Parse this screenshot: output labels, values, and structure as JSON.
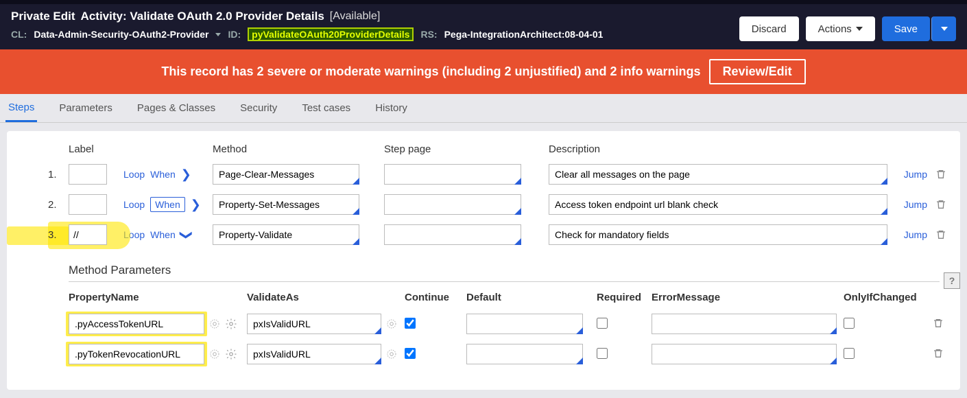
{
  "header": {
    "prefix": "Private Edit",
    "title": "Activity: Validate OAuth 2.0 Provider Details",
    "status": "[Available]",
    "cl_key": "CL:",
    "cl_val": "Data-Admin-Security-OAuth2-Provider",
    "id_key": "ID:",
    "id_val": "pyValidateOAuth20ProviderDetails",
    "rs_key": "RS:",
    "rs_val": "Pega-IntegrationArchitect:08-04-01",
    "buttons": {
      "discard": "Discard",
      "actions": "Actions",
      "save": "Save"
    }
  },
  "warning": {
    "text": "This record has 2 severe or moderate warnings (including 2 unjustified) and 2 info warnings",
    "review": "Review/Edit"
  },
  "tabs": [
    "Steps",
    "Parameters",
    "Pages & Classes",
    "Security",
    "Test cases",
    "History"
  ],
  "columns": {
    "label": "Label",
    "method": "Method",
    "step_page": "Step page",
    "description": "Description"
  },
  "steps": [
    {
      "num": "1.",
      "label": "",
      "loop": "Loop",
      "when": "When",
      "when_boxed": false,
      "expanded": false,
      "method": "Page-Clear-Messages",
      "step_page": "",
      "desc": "Clear all messages on the page",
      "jump": "Jump"
    },
    {
      "num": "2.",
      "label": "",
      "loop": "Loop",
      "when": "When",
      "when_boxed": true,
      "expanded": false,
      "method": "Property-Set-Messages",
      "step_page": "",
      "desc": "Access token endpoint url blank check",
      "jump": "Jump"
    },
    {
      "num": "3.",
      "label": "//",
      "loop": "Loop",
      "when": "When",
      "when_boxed": false,
      "expanded": true,
      "highlight": true,
      "method": "Property-Validate",
      "step_page": "",
      "desc": "Check for mandatory fields",
      "jump": "Jump"
    }
  ],
  "method_params": {
    "title": "Method Parameters",
    "columns": {
      "prop": "PropertyName",
      "validate": "ValidateAs",
      "continue": "Continue",
      "default": "Default",
      "required": "Required",
      "errmsg": "ErrorMessage",
      "onlyif": "OnlyIfChanged"
    },
    "rows": [
      {
        "prop": ".pyAccessTokenURL",
        "validate": "pxIsValidURL",
        "continue": true,
        "default": "",
        "required": false,
        "errmsg": "",
        "onlyif": false,
        "highlight": true
      },
      {
        "prop": ".pyTokenRevocationURL",
        "validate": "pxIsValidURL",
        "continue": true,
        "default": "",
        "required": false,
        "errmsg": "",
        "onlyif": false,
        "highlight": true
      }
    ]
  }
}
